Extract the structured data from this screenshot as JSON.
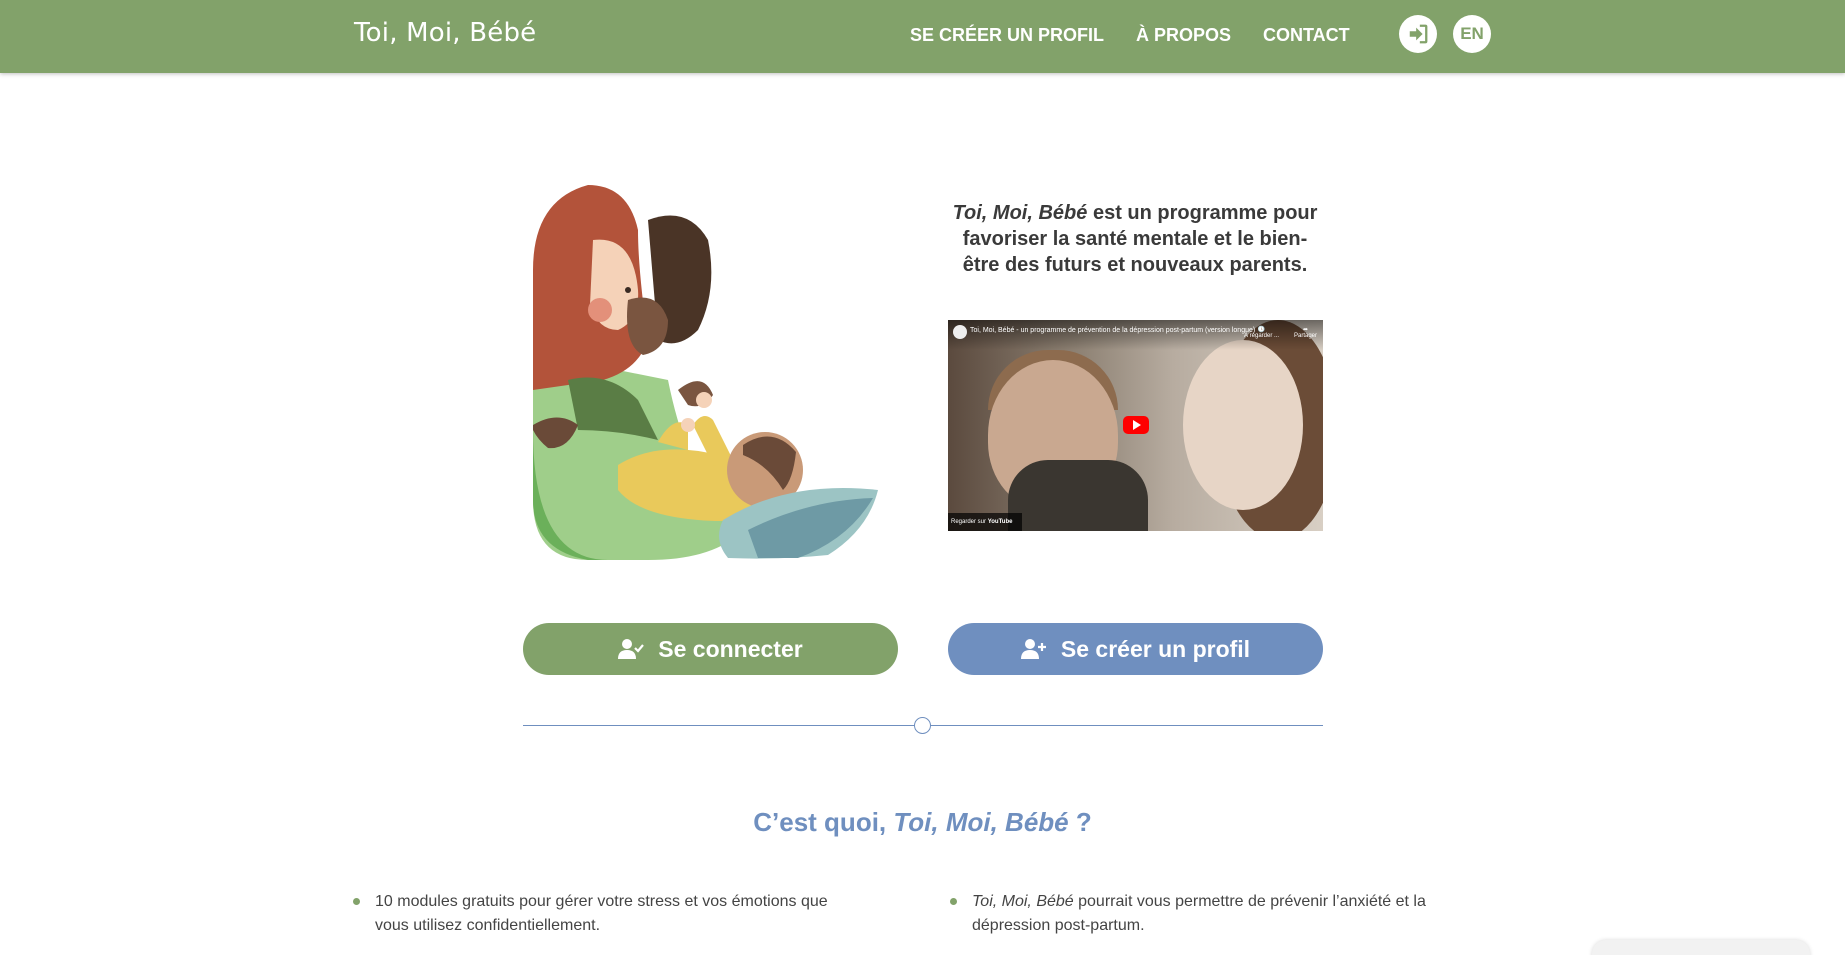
{
  "header": {
    "logo": "Toi, Moi, Bébé",
    "nav": {
      "create_profile": "SE CRÉER UN PROFIL",
      "about": "À PROPOS",
      "contact": "CONTACT"
    },
    "login_icon": "sign-in-icon",
    "language": "EN"
  },
  "hero": {
    "illustration": "parents-with-baby-illustration",
    "intro_title": "Toi, Moi, Bébé",
    "intro_rest": " est un programme pour favoriser la santé mentale et le bien-être des futurs et nouveaux parents.",
    "video": {
      "title": "Toi, Moi, Bébé - un programme de prévention de la dépression post-partum (version longue)",
      "watch_later": "À regarder ...",
      "share": "Partager",
      "watch_on": "Regarder sur",
      "youtube": "YouTube"
    }
  },
  "actions": {
    "login_label": "Se connecter",
    "login_icon": "user-check-icon",
    "signup_label": "Se créer un profil",
    "signup_icon": "user-plus-icon"
  },
  "section": {
    "title_prefix": "C’est quoi, ",
    "title_italic": "Toi, Moi, Bébé",
    "title_suffix": " ?",
    "bullets": [
      {
        "italic": "",
        "text": "10 modules gratuits pour gérer votre stress et vos émotions que vous utilisez confidentiellement."
      },
      {
        "italic": "Toi, Moi, Bébé",
        "text": " pourrait vous permettre de prévenir l’anxiété et la dépression post-partum."
      }
    ]
  },
  "colors": {
    "primary_green": "#82a26a",
    "secondary_blue": "#6f8fbf"
  }
}
